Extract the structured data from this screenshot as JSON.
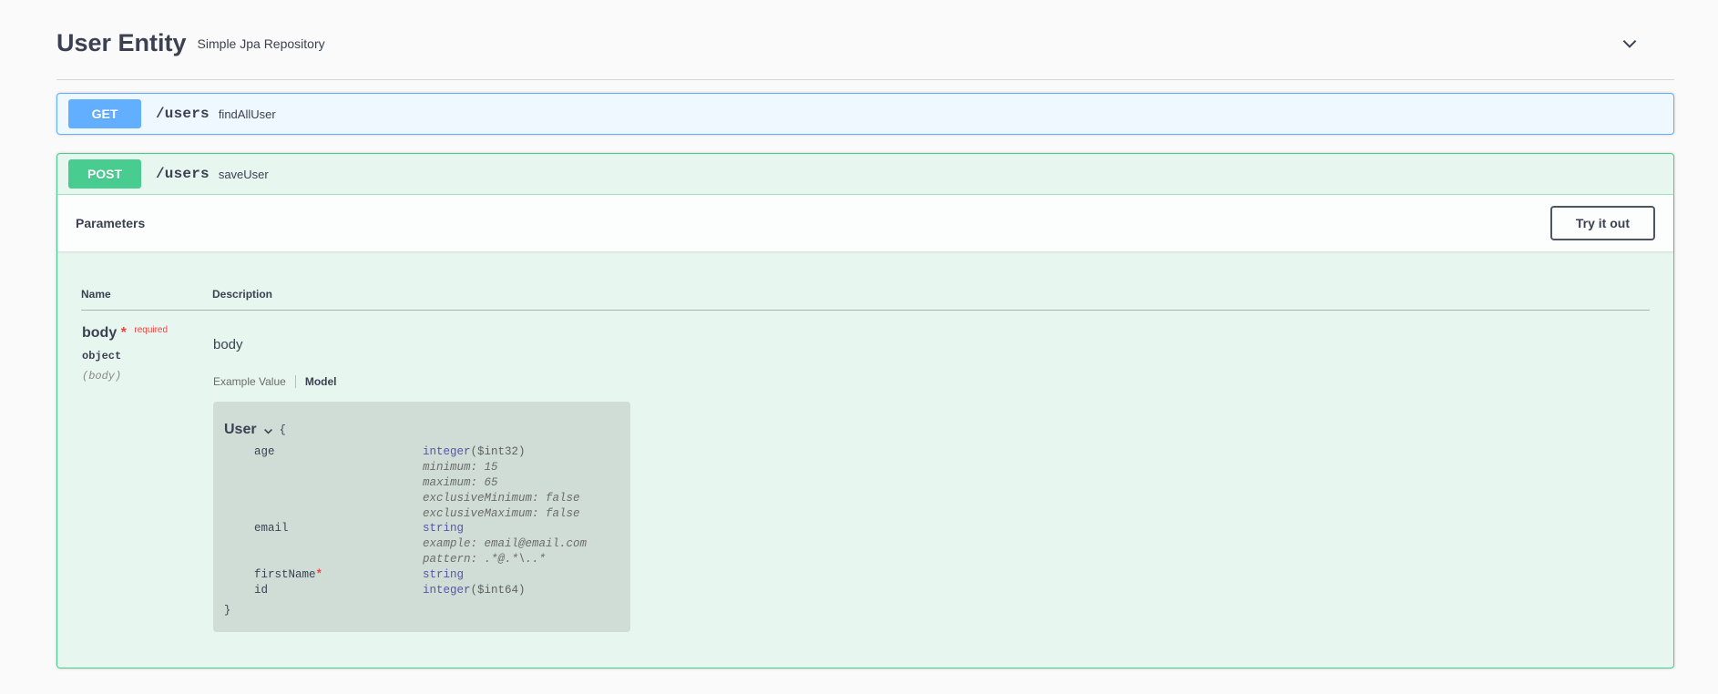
{
  "section": {
    "title": "User Entity",
    "subtitle": "Simple Jpa Repository"
  },
  "operations": [
    {
      "method": "GET",
      "path": "/users",
      "summary": "findAllUser"
    },
    {
      "method": "POST",
      "path": "/users",
      "summary": "saveUser"
    }
  ],
  "parameters_panel": {
    "title": "Parameters",
    "try_it_out_label": "Try it out",
    "columns": [
      "Name",
      "Description"
    ],
    "param": {
      "name": "body",
      "required_mark": "*",
      "required_label": "required",
      "type": "object",
      "location": "(body)",
      "description": "body",
      "tabs": [
        {
          "label": "Example Value",
          "active": false
        },
        {
          "label": "Model",
          "active": true
        }
      ]
    }
  },
  "model": {
    "title": "User",
    "open_brace": "{",
    "close_brace": "}",
    "required_mark": "*",
    "properties": [
      {
        "name": "age",
        "type": "integer",
        "format": "($int32)",
        "constraints": [
          "minimum: 15",
          "maximum: 65",
          "exclusiveMinimum: false",
          "exclusiveMaximum: false"
        ]
      },
      {
        "name": "email",
        "type": "string",
        "format": "",
        "constraints": [
          "example: email@email.com",
          "pattern: .*@.*\\..*"
        ]
      },
      {
        "name": "firstName",
        "required": true,
        "type": "string",
        "format": "",
        "constraints": []
      },
      {
        "name": "id",
        "type": "integer",
        "format": "($int64)",
        "constraints": []
      }
    ]
  },
  "colors": {
    "get": "#61affe",
    "post": "#49cc90",
    "prop_type": "#55a",
    "required": "#f93e3e"
  }
}
